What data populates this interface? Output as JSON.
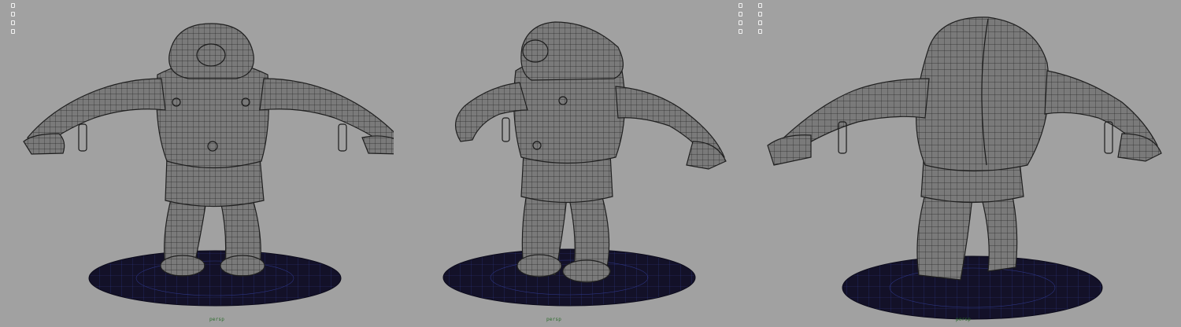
{
  "viewports": [
    {
      "label": "persp"
    },
    {
      "label": "persp"
    },
    {
      "label": "persp"
    }
  ],
  "colors": {
    "background": "#a1a1a1",
    "mesh_fill": "#787878",
    "wire": "#2a2a2a",
    "base": "#131128",
    "base_grid": "#2c3480"
  }
}
